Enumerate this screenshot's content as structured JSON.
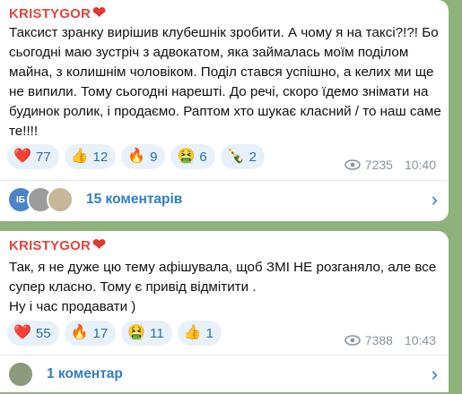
{
  "posts": [
    {
      "author": "KRISTYGOR",
      "text": "Таксист зранку вирішив клубешнік зробити. А чому я на таксі?!?! Бо сьогодні маю зустріч з адвокатом, яка займалась моїм поділом майна, з колишнім чоловіком. Поділ стався успішно, а келих ми ще не випили. Тому сьогодні нарешті. До речі, скоро їдемо знімати на будинок ролик, і продаємо. Раптом хто шукає класний / то наш саме те!!!!",
      "reactions": [
        {
          "emoji": "❤️",
          "icon": "heart-icon",
          "count": "77"
        },
        {
          "emoji": "👍",
          "icon": "thumbs-up-icon",
          "count": "12"
        },
        {
          "emoji": "🔥",
          "icon": "fire-icon",
          "count": "9"
        },
        {
          "emoji": "🤮",
          "icon": "nauseated-face-icon",
          "count": "6"
        },
        {
          "emoji": "🍾",
          "icon": "champagne-icon",
          "count": "2"
        }
      ],
      "views": "7235",
      "time": "10:40",
      "comments": {
        "label": "15 коментарів",
        "avatars": [
          {
            "initials": "ІБ",
            "color": "#4a84c9"
          },
          {
            "initials": "",
            "color": "#9c9c9c"
          },
          {
            "initials": "",
            "color": "#c7b79a"
          }
        ]
      }
    },
    {
      "author": "KRISTYGOR",
      "text": "Так, я не дуже цю тему афішувала, щоб ЗМІ НЕ розганяло, але все супер класно. Тому є привід відмітити .\nНу і час продавати )",
      "reactions": [
        {
          "emoji": "❤️",
          "icon": "heart-icon",
          "count": "55"
        },
        {
          "emoji": "🔥",
          "icon": "fire-icon",
          "count": "17"
        },
        {
          "emoji": "🤮",
          "icon": "nauseated-face-icon",
          "count": "11"
        },
        {
          "emoji": "👍",
          "icon": "thumbs-up-icon",
          "count": "1"
        }
      ],
      "views": "7388",
      "time": "10:43",
      "comments": {
        "label": "1 коментар",
        "avatars": [
          {
            "initials": "",
            "color": "#8a9a7a"
          }
        ]
      }
    }
  ],
  "icons": {
    "heart": "❤",
    "eye": "eye-icon",
    "chevron": "chevron-right-icon"
  },
  "colors": {
    "author": "#e0463f",
    "link": "#2e7fc4",
    "pill_bg": "#e8f1f9",
    "background": "#8fb27c"
  }
}
